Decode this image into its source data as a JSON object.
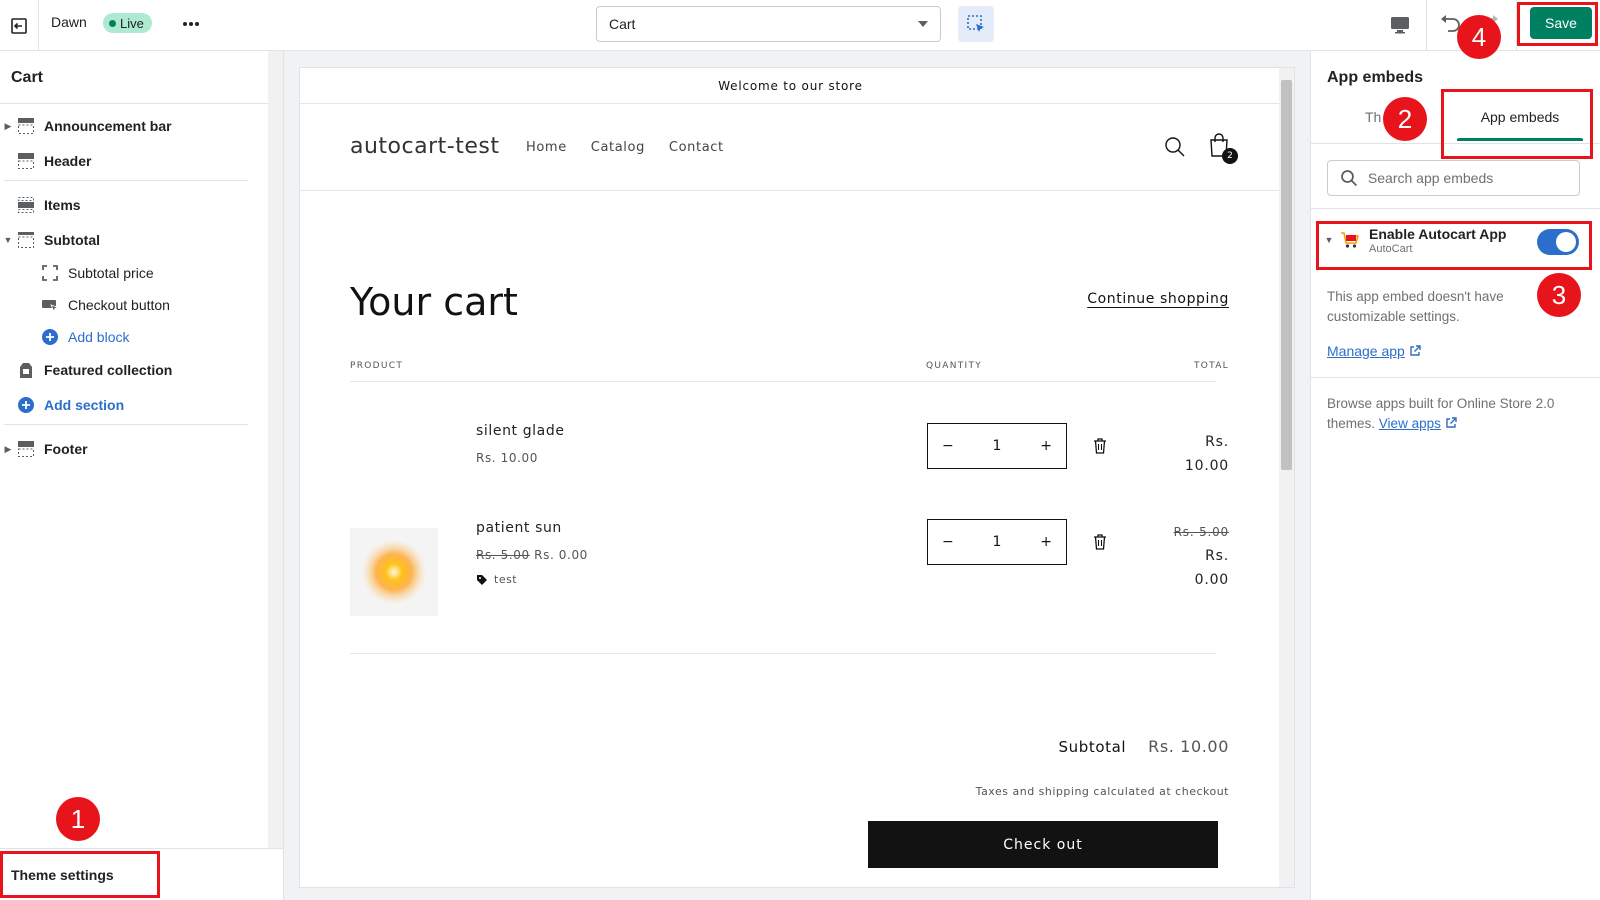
{
  "topbar": {
    "theme_name": "Dawn",
    "status_badge": "Live",
    "page_selector": "Cart",
    "save_label": "Save"
  },
  "sidebar": {
    "title": "Cart",
    "items": [
      {
        "label": "Announcement bar"
      },
      {
        "label": "Header"
      },
      {
        "label": "Items"
      },
      {
        "label": "Subtotal"
      },
      {
        "label": "Subtotal price"
      },
      {
        "label": "Checkout button"
      },
      {
        "label": "Add block"
      },
      {
        "label": "Featured collection"
      },
      {
        "label": "Add section"
      },
      {
        "label": "Footer"
      }
    ],
    "theme_settings": "Theme settings"
  },
  "preview": {
    "announcement": "Welcome to our store",
    "store_name": "autocart-test",
    "nav": [
      "Home",
      "Catalog",
      "Contact"
    ],
    "cart_count": "2",
    "cart_title": "Your cart",
    "continue_shopping": "Continue shopping",
    "col_product": "PRODUCT",
    "col_quantity": "QUANTITY",
    "col_total": "TOTAL",
    "products": [
      {
        "name": "silent glade",
        "price": "Rs. 10.00",
        "qty": "1",
        "total_line1": "Rs.",
        "total_line2": "10.00"
      },
      {
        "name": "patient sun",
        "old_price": "Rs. 5.00",
        "price": "Rs. 0.00",
        "tag": "test",
        "qty": "1",
        "old_total": "Rs. 5.00",
        "total_line1": "Rs.",
        "total_line2": "0.00"
      }
    ],
    "subtotal_label": "Subtotal",
    "subtotal_value": "Rs. 10.00",
    "tax_note": "Taxes and shipping calculated at checkout",
    "checkout_label": "Check out"
  },
  "right_panel": {
    "title": "App embeds",
    "tab_theme": "Th",
    "tab_app_embeds": "App embeds",
    "search_placeholder": "Search app embeds",
    "embed": {
      "name": "Enable Autocart App",
      "provider": "AutoCart",
      "enabled": true
    },
    "no_settings_note": "This app embed doesn't have customizable settings.",
    "manage_app": "Manage app",
    "browse_text": "Browse apps built for Online Store 2.0 themes.",
    "view_apps": "View apps"
  },
  "annotations": [
    "1",
    "2",
    "3",
    "4"
  ],
  "colors": {
    "save_green": "#008060",
    "annotation_red": "#e8141b",
    "toggle_blue": "#2c6ecb"
  }
}
